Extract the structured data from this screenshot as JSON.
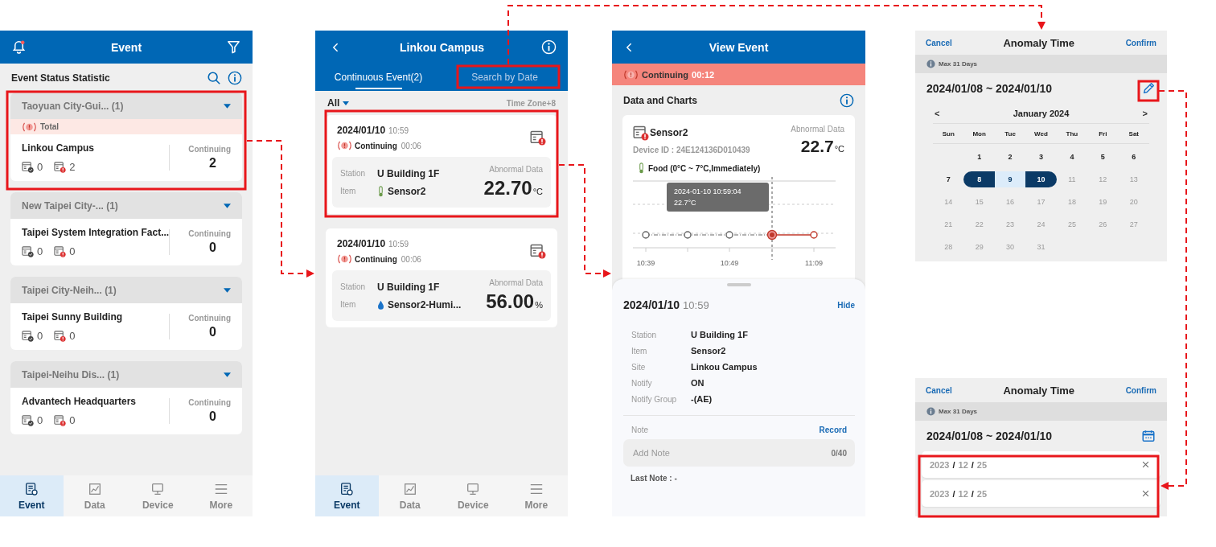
{
  "event_screen": {
    "title": "Event",
    "section_title": "Event Status Statistic",
    "groups": [
      {
        "region": "Taoyuan City-Gui... (1)",
        "banner": "Total",
        "site": "Linkou Campus",
        "resolved": "0",
        "abnormal": "2",
        "status_label": "Continuing",
        "count": "2"
      },
      {
        "region": "New Taipei City-... (1)",
        "site": "Taipei System Integration Fact...",
        "resolved": "0",
        "abnormal": "0",
        "status_label": "Continuing",
        "count": "0"
      },
      {
        "region": "Taipei City-Neih... (1)",
        "site": "Taipei Sunny Building",
        "resolved": "0",
        "abnormal": "0",
        "status_label": "Continuing",
        "count": "0"
      },
      {
        "region": "Taipei-Neihu Dis... (1)",
        "site": "Advantech Headquarters",
        "resolved": "0",
        "abnormal": "0",
        "status_label": "Continuing",
        "count": "0"
      }
    ],
    "tab_bar": [
      {
        "label": "Event",
        "selected": true
      },
      {
        "label": "Data",
        "selected": false
      },
      {
        "label": "Device",
        "selected": false
      },
      {
        "label": "More",
        "selected": false
      }
    ]
  },
  "event_list_screen": {
    "title": "Linkou Campus",
    "tabs": [
      {
        "label": "Continuous Event(2)",
        "selected": true
      },
      {
        "label": "Search by Date",
        "selected": false
      }
    ],
    "filter": "All",
    "time_zone": "Time Zone+8",
    "events": [
      {
        "date": "2024/01/10",
        "time": "10:59",
        "status": "Continuing",
        "duration": "00:06",
        "station_label": "Station",
        "station": "U Building 1F",
        "item_label": "Item",
        "kind": "temperature",
        "item": "Sensor2",
        "data_label": "Abnormal Data",
        "value": "22.70",
        "unit": "°C"
      },
      {
        "date": "2024/01/10",
        "time": "10:59",
        "status": "Continuing",
        "duration": "00:06",
        "station_label": "Station",
        "station": "U Building 1F",
        "item_label": "Item",
        "kind": "humidity",
        "item": "Sensor2-Humi...",
        "data_label": "Abnormal Data",
        "value": "56.00",
        "unit": "%"
      }
    ],
    "tab_bar": [
      {
        "label": "Event",
        "selected": true
      },
      {
        "label": "Data",
        "selected": false
      },
      {
        "label": "Device",
        "selected": false
      },
      {
        "label": "More",
        "selected": false
      }
    ]
  },
  "view_event_screen": {
    "title": "View Event",
    "status": "Continuing",
    "duration": "00:12",
    "section_title": "Data and Charts",
    "sensor": {
      "name": "Sensor2",
      "device_id": "Device ID : 24E124136D010439",
      "data_label": "Abnormal Data",
      "value": "22.7",
      "unit": "°C",
      "rule": "Food (0°C ~ 7°C,Immediately)",
      "tooltip": [
        "2024-01-10 10:59:04",
        "22.7°C"
      ],
      "x_labels": [
        "10:39",
        "10:49",
        "11:09"
      ]
    },
    "sheet": {
      "date": "2024/01/10",
      "time": "10:59",
      "hide": "Hide",
      "details": [
        {
          "label": "Station",
          "value": "U Building 1F"
        },
        {
          "label": "Item",
          "value": "Sensor2"
        },
        {
          "label": "Site",
          "value": "Linkou Campus"
        },
        {
          "label": "Notify",
          "value": "ON"
        },
        {
          "label": "Notify Group",
          "value": "-(AE)"
        }
      ],
      "note_label": "Note",
      "record": "Record",
      "note_placeholder": "Add Note",
      "note_counter": "0/40",
      "last_note": "Last Note : -"
    }
  },
  "date_pickers": [
    {
      "kind": "calendar",
      "cancel": "Cancel",
      "title": "Anomaly Time",
      "confirm": "Confirm",
      "hint": "Max 31 Days",
      "range": "2024/01/08 ~ 2024/01/10",
      "prev": "<",
      "month": "January 2024",
      "next": ">",
      "weekdays": [
        "Sun",
        "Mon",
        "Tue",
        "Wed",
        "Thu",
        "Fri",
        "Sat"
      ],
      "days": [
        {
          "label": "1",
          "disabled": false,
          "selected": false
        },
        {
          "label": "2",
          "disabled": false,
          "selected": false
        },
        {
          "label": "3",
          "disabled": false,
          "selected": false
        },
        {
          "label": "4",
          "disabled": false,
          "selected": false
        },
        {
          "label": "5",
          "disabled": false,
          "selected": false
        },
        {
          "label": "6",
          "disabled": false,
          "selected": false
        },
        {
          "label": "7",
          "disabled": false,
          "selected": false
        },
        {
          "label": "8",
          "disabled": false,
          "selected": true,
          "endpoint": true
        },
        {
          "label": "9",
          "disabled": false,
          "selected": true,
          "endpoint": false
        },
        {
          "label": "10",
          "disabled": false,
          "selected": true,
          "endpoint": true
        },
        {
          "label": "11",
          "disabled": true,
          "selected": false
        },
        {
          "label": "12",
          "disabled": true,
          "selected": false
        },
        {
          "label": "13",
          "disabled": true,
          "selected": false
        },
        {
          "label": "14",
          "disabled": true,
          "selected": false
        },
        {
          "label": "15",
          "disabled": true,
          "selected": false
        },
        {
          "label": "16",
          "disabled": true,
          "selected": false
        },
        {
          "label": "17",
          "disabled": true,
          "selected": false
        },
        {
          "label": "18",
          "disabled": true,
          "selected": false
        },
        {
          "label": "19",
          "disabled": true,
          "selected": false
        },
        {
          "label": "20",
          "disabled": true,
          "selected": false
        },
        {
          "label": "21",
          "disabled": true,
          "selected": false
        },
        {
          "label": "22",
          "disabled": true,
          "selected": false
        },
        {
          "label": "23",
          "disabled": true,
          "selected": false
        },
        {
          "label": "24",
          "disabled": true,
          "selected": false
        },
        {
          "label": "25",
          "disabled": true,
          "selected": false
        },
        {
          "label": "26",
          "disabled": true,
          "selected": false
        },
        {
          "label": "27",
          "disabled": true,
          "selected": false
        },
        {
          "label": "28",
          "disabled": true,
          "selected": false
        },
        {
          "label": "29",
          "disabled": true,
          "selected": false
        },
        {
          "label": "30",
          "disabled": true,
          "selected": false
        },
        {
          "label": "31",
          "disabled": true,
          "selected": false
        }
      ]
    },
    {
      "kind": "input",
      "cancel": "Cancel",
      "title": "Anomaly Time",
      "confirm": "Confirm",
      "hint": "Max 31 Days",
      "range": "2024/01/08 ~ 2024/01/10",
      "fields": [
        {
          "segments": [
            {
              "kind": "placeholder",
              "text": "2023"
            },
            {
              "kind": "separator",
              "text": "/"
            },
            {
              "kind": "placeholder",
              "text": "12"
            },
            {
              "kind": "separator",
              "text": "/"
            },
            {
              "kind": "placeholder",
              "text": "25"
            }
          ]
        },
        {
          "segments": [
            {
              "kind": "placeholder",
              "text": "2023"
            },
            {
              "kind": "separator",
              "text": "/"
            },
            {
              "kind": "placeholder",
              "text": "12"
            },
            {
              "kind": "separator",
              "text": "/"
            },
            {
              "kind": "placeholder",
              "text": "25"
            }
          ]
        }
      ]
    }
  ]
}
